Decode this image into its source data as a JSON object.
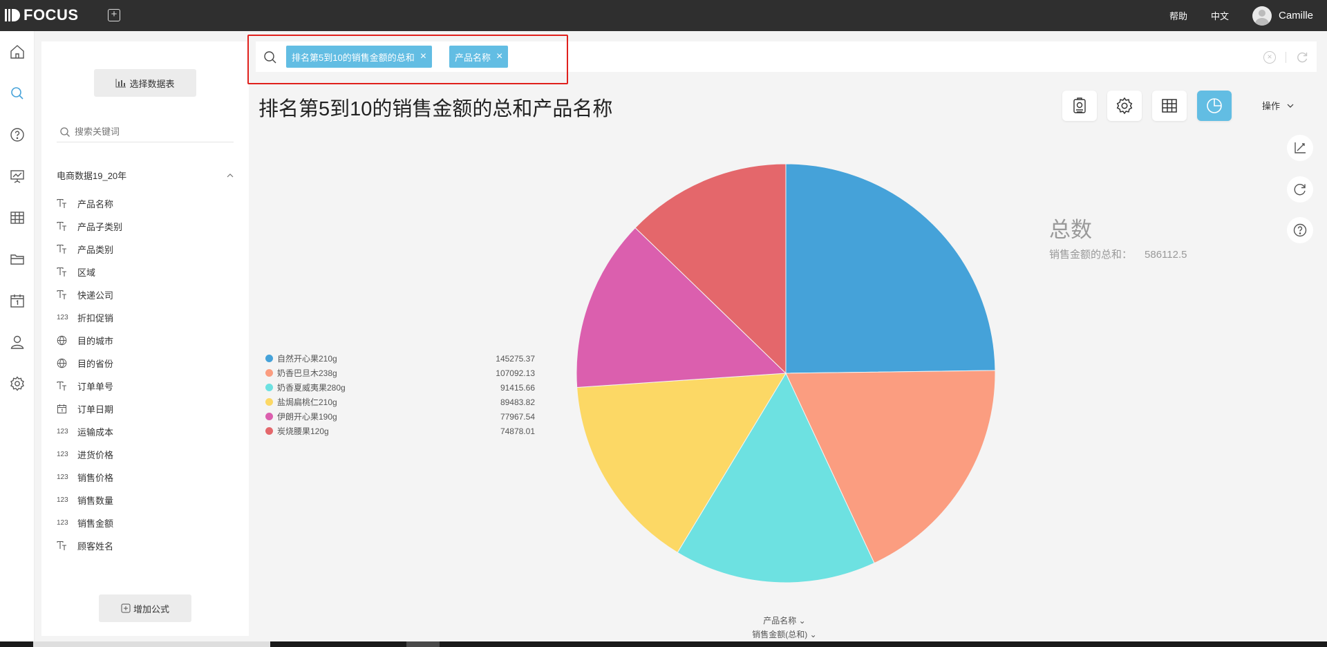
{
  "app": {
    "logo": "FOCUS"
  },
  "topbar": {
    "help": "帮助",
    "language": "中文",
    "user": "Camille"
  },
  "panel": {
    "select_table": "选择数据表",
    "search_placeholder": "搜索关键词",
    "group_name": "电商数据19_20年",
    "fields": [
      {
        "type": "text",
        "label": "产品名称"
      },
      {
        "type": "text",
        "label": "产品子类别"
      },
      {
        "type": "text",
        "label": "产品类别"
      },
      {
        "type": "text",
        "label": "区域"
      },
      {
        "type": "text",
        "label": "快递公司"
      },
      {
        "type": "number",
        "type_label": "123",
        "label": "折扣促销"
      },
      {
        "type": "geo",
        "label": "目的城市"
      },
      {
        "type": "geo",
        "label": "目的省份"
      },
      {
        "type": "text",
        "label": "订单单号"
      },
      {
        "type": "date",
        "label": "订单日期"
      },
      {
        "type": "number",
        "type_label": "123",
        "label": "运输成本"
      },
      {
        "type": "number",
        "type_label": "123",
        "label": "进货价格"
      },
      {
        "type": "number",
        "type_label": "123",
        "label": "销售价格"
      },
      {
        "type": "number",
        "type_label": "123",
        "label": "销售数量"
      },
      {
        "type": "number",
        "type_label": "123",
        "label": "销售金额"
      },
      {
        "type": "text",
        "label": "顾客姓名"
      }
    ],
    "add_formula": "增加公式"
  },
  "search": {
    "tokens": [
      "排名第5到10的销售金额的总和",
      "产品名称"
    ]
  },
  "main": {
    "title": "排名第5到10的销售金额的总和产品名称",
    "operations": "操作",
    "total_title": "总数",
    "total_label": "销售金额的总和：",
    "total_value": "586112.5",
    "x_control": "产品名称",
    "y_control": "销售金额(总和)"
  },
  "colors": {
    "accent": "#62bde3",
    "highlight": "#e0201c"
  },
  "chart_data": {
    "type": "pie",
    "categories": [
      "自然开心果210g",
      "奶香巴旦木238g",
      "奶香夏威夷果280g",
      "盐焗扁桃仁210g",
      "伊朗开心果190g",
      "炭烧腰果120g"
    ],
    "values": [
      145275.37,
      107092.13,
      91415.66,
      89483.82,
      77967.54,
      74878.01
    ],
    "value_labels": [
      "145275.37",
      "107092.13",
      "91415.66",
      "89483.82",
      "77967.54",
      "74878.01"
    ],
    "colors": [
      "#45a2d9",
      "#fb9d80",
      "#6de1e1",
      "#fcd865",
      "#db5fae",
      "#e4676b"
    ],
    "legend_position": "left"
  }
}
